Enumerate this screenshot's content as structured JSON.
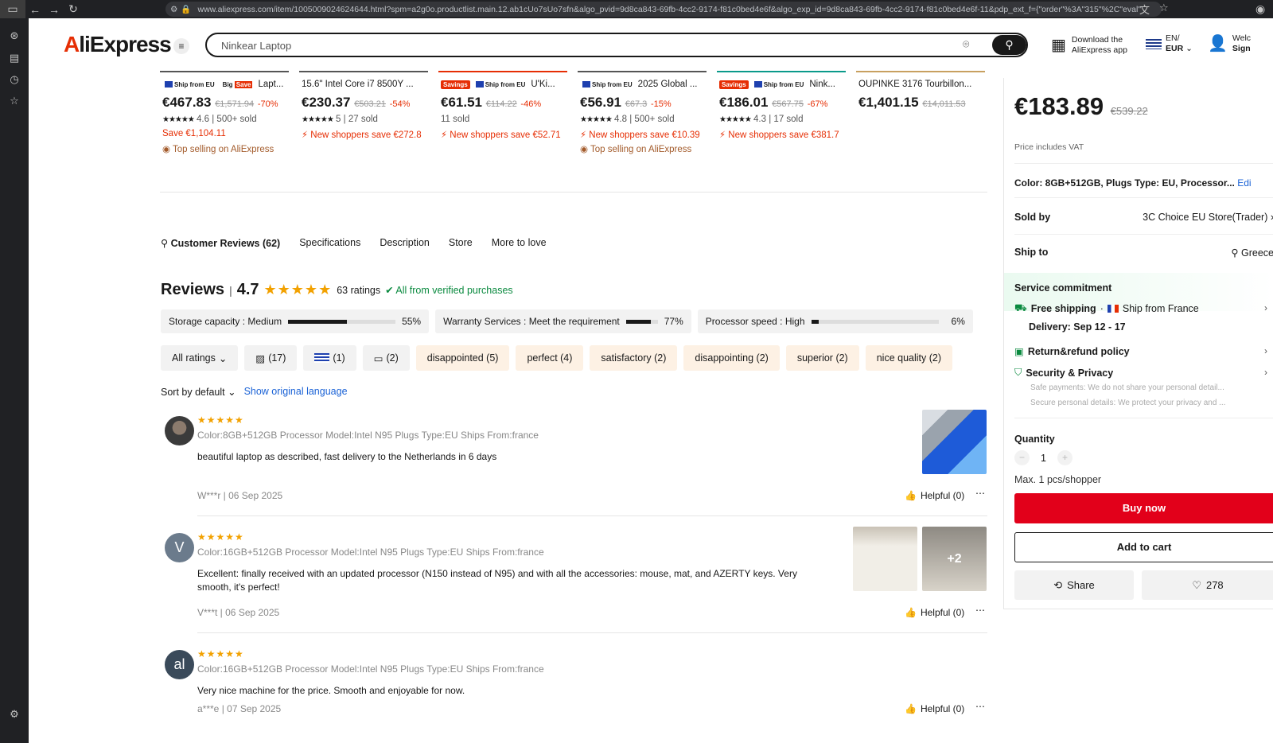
{
  "browser": {
    "url": "www.aliexpress.com/item/1005009024624644.html?spm=a2g0o.productlist.main.12.ab1cUo7sUo7sfn&algo_pvid=9d8ca843-69fb-4cc2-9174-f81c0bed4e6f&algo_exp_id=9d8ca843-69fb-4cc2-9174-f81c0bed4e6f-11&pdp_ext_f={\"order\"%3A\"315\"%2C\"eval\""
  },
  "header": {
    "logo_a": "A",
    "logo_rest": "liExpress",
    "search_value": "Ninkear Laptop",
    "download_line1": "Download the",
    "download_line2": "AliExpress app",
    "lang_line1": "EN/",
    "lang_line2": "EUR",
    "user_line1": "Welc",
    "user_line2": "Sign"
  },
  "recommendations": [
    {
      "badges": [
        "Ship from EU",
        "Big Save"
      ],
      "title": "Lapt...",
      "price": "€467.83",
      "old": "€1,571.94",
      "off": "-70%",
      "rating": "4.6",
      "sold": "500+ sold",
      "promo": "Save €1,104.11",
      "promo2": "Top selling on AliExpress"
    },
    {
      "badges": [],
      "title": "15.6\" Intel Core i7 8500Y ...",
      "price": "€230.37",
      "old": "€503.21",
      "off": "-54%",
      "rating": "5",
      "sold": "27 sold",
      "promo": "New shoppers save €272.8",
      "promo2": ""
    },
    {
      "badges": [
        "Savings",
        "Ship from EU"
      ],
      "title": "U'Ki...",
      "price": "€61.51",
      "old": "€114.22",
      "off": "-46%",
      "rating": "",
      "sold": "11 sold",
      "promo": "New shoppers save €52.71",
      "promo2": ""
    },
    {
      "badges": [
        "Ship from EU"
      ],
      "title": "2025 Global ...",
      "price": "€56.91",
      "old": "€67.3",
      "off": "-15%",
      "rating": "4.8",
      "sold": "500+ sold",
      "promo": "New shoppers save €10.39",
      "promo2": "Top selling on AliExpress"
    },
    {
      "badges": [
        "Savings",
        "Ship from EU"
      ],
      "title": "Nink...",
      "price": "€186.01",
      "old": "€567.75",
      "off": "-67%",
      "rating": "4.3",
      "sold": "17 sold",
      "promo": "New shoppers save €381.7",
      "promo2": ""
    },
    {
      "badges": [],
      "title": "OUPINKE 3176 Tourbillon...",
      "price": "€1,401.15",
      "old": "€14,011.53",
      "off": "",
      "rating": "",
      "sold": "",
      "promo": "",
      "promo2": ""
    }
  ],
  "tabs": [
    "Customer Reviews (62)",
    "Specifications",
    "Description",
    "Store",
    "More to love"
  ],
  "reviews_header": {
    "title": "Reviews",
    "score": "4.7",
    "ratings": "63 ratings",
    "verified": "All from verified purchases"
  },
  "attributes": [
    {
      "label": "Storage capacity : Medium",
      "pct": "55%",
      "value": 55
    },
    {
      "label": "Warranty Services : Meet the requirement",
      "pct": "77%",
      "value": 77
    },
    {
      "label": "Processor speed : High",
      "pct": "6%",
      "value": 6
    }
  ],
  "filters": {
    "all": "All ratings",
    "photos": "(17)",
    "country": "(1)",
    "comments": "(2)",
    "tags": [
      "disappointed (5)",
      "perfect (4)",
      "satisfactory (2)",
      "disappointing (2)",
      "superior (2)",
      "nice quality (2)"
    ]
  },
  "sort": {
    "label": "Sort by default",
    "original": "Show original language"
  },
  "reviews": [
    {
      "initial": "",
      "sku": "Color:8GB+512GB Processor Model:Intel N95 Plugs Type:EU Ships From:france",
      "text": "beautiful laptop as described, fast delivery to the Netherlands in 6 days",
      "meta": "W***r | 06 Sep 2025",
      "helpful": "Helpful (0)",
      "extra": ""
    },
    {
      "initial": "V",
      "sku": "Color:16GB+512GB Processor Model:Intel N95 Plugs Type:EU Ships From:france",
      "text": "Excellent: finally received with an updated processor (N150 instead of N95) and with all the accessories: mouse, mat, and AZERTY keys. Very smooth, it's perfect!",
      "meta": "V***t | 06 Sep 2025",
      "helpful": "Helpful (0)",
      "extra": "+2"
    },
    {
      "initial": "al",
      "sku": "Color:16GB+512GB Processor Model:Intel N95 Plugs Type:EU Ships From:france",
      "text": "Very nice machine for the price. Smooth and enjoyable for now.",
      "meta": "a***e | 07 Sep 2025",
      "helpful": "Helpful (0)",
      "extra": ""
    }
  ],
  "panel": {
    "price": "€183.89",
    "old_price": "€539.22",
    "vat": "Price includes VAT",
    "color": "Color: 8GB+512GB, Plugs Type: EU, Processor...",
    "edit": "Edi",
    "sold_by_label": "Sold by",
    "sold_by": "3C Choice EU Store(Trader)",
    "ship_to_label": "Ship to",
    "ship_to": "Greece",
    "service": "Service commitment",
    "free_shipping": "Free shipping",
    "ship_from": "Ship from France",
    "delivery": "Delivery: Sep 12 - 17",
    "refund": "Return&refund policy",
    "security": "Security & Privacy",
    "sec1": "Safe payments: We do not share your personal detail...",
    "sec2": "Secure personal details: We protect your privacy and ...",
    "qty_label": "Quantity",
    "qty": "1",
    "max": "Max. 1 pcs/shopper",
    "buy": "Buy now",
    "cart": "Add to cart",
    "share": "Share",
    "likes": "278"
  }
}
